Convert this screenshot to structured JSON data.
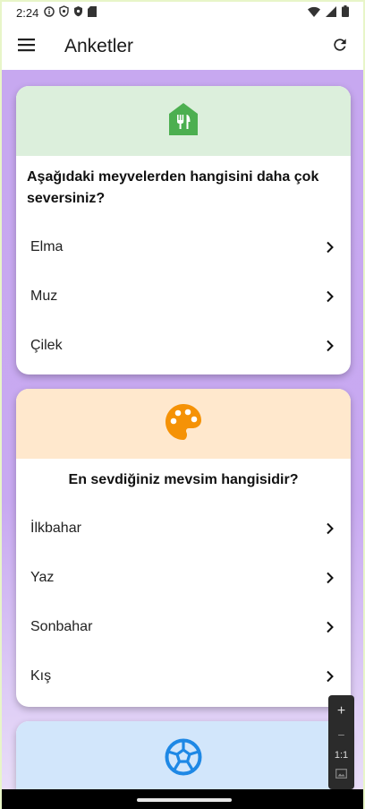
{
  "status_bar": {
    "time": "2:24",
    "icons": [
      "info-icon",
      "shield-outline-icon",
      "shield-filled-icon",
      "sd-card-icon",
      "wifi-icon",
      "signal-icon",
      "battery-icon"
    ]
  },
  "app_bar": {
    "title": "Anketler",
    "menu_icon": "hamburger-menu-icon",
    "refresh_icon": "refresh-icon"
  },
  "surveys": [
    {
      "icon": "restaurant-house-icon",
      "header_color": "#dcefdc",
      "icon_color": "#4caf50",
      "question": "Aşağıdaki meyvelerden hangisini daha çok seversiniz?",
      "options": [
        "Elma",
        "Muz",
        "Çilek"
      ]
    },
    {
      "icon": "palette-icon",
      "header_color": "#ffe8cd",
      "icon_color": "#f59206",
      "question": "En sevdiğiniz mevsim hangisidir?",
      "options": [
        "İlkbahar",
        "Yaz",
        "Sonbahar",
        "Kış"
      ]
    },
    {
      "icon": "soccer-ball-icon",
      "header_color": "#d2e6fb",
      "icon_color": "#1e88e5"
    }
  ],
  "zoom_panel": {
    "plus": "+",
    "minus": "−",
    "ratio": "1:1"
  },
  "colors": {
    "background_purple": "#c7a8f0",
    "chevron": "#111111"
  }
}
